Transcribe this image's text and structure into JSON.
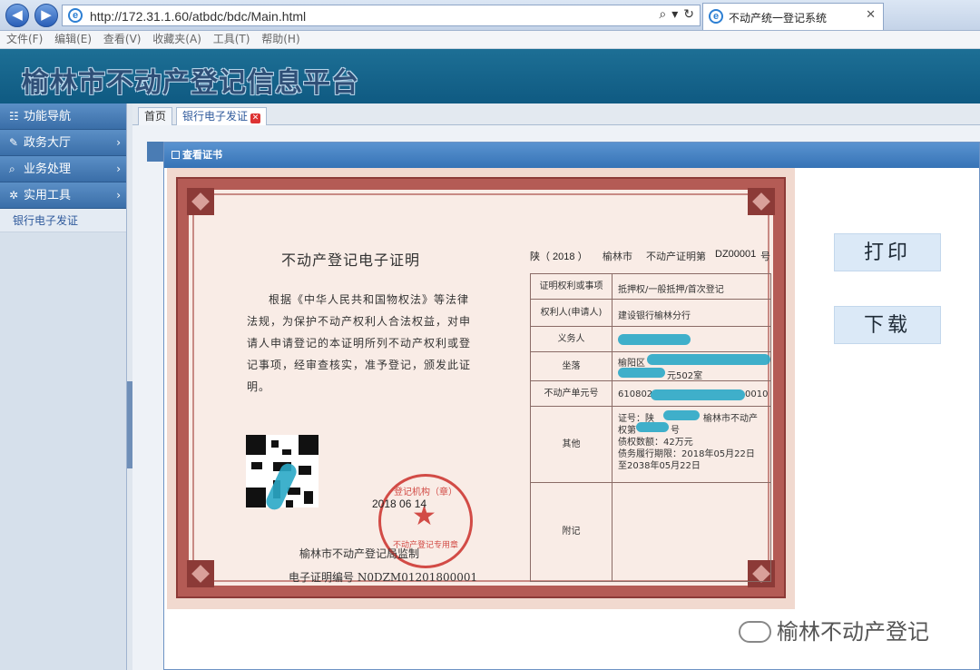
{
  "browser": {
    "url": "http://172.31.1.60/atbdc/bdc/Main.html",
    "tab_title": "不动产统一登记系统",
    "menu": [
      "文件(F)",
      "编辑(E)",
      "查看(V)",
      "收藏夹(A)",
      "工具(T)",
      "帮助(H)"
    ]
  },
  "app": {
    "title": "榆林市不动产登记信息平台"
  },
  "sidebar": {
    "items": [
      {
        "label": "功能导航",
        "icon": "list-icon"
      },
      {
        "label": "政务大厅",
        "icon": "edit-icon"
      },
      {
        "label": "业务处理",
        "icon": "search-icon"
      },
      {
        "label": "实用工具",
        "icon": "gear-icon"
      }
    ],
    "sub": "银行电子发证"
  },
  "tabs": [
    {
      "label": "首页"
    },
    {
      "label": "银行电子发证"
    }
  ],
  "dialog": {
    "title": "查看证书",
    "print_label": "打印",
    "download_label": "下载"
  },
  "certificate": {
    "title": "不动产登记电子证明",
    "body": "根据《中华人民共和国物权法》等法律法规，为保护不动产权利人合法权益，对申请人申请登记的本证明所列不动产权利或登记事项，经审查核实，准予登记，颁发此证明。",
    "seal_text": "登记机构（章）",
    "seal_label": "不动产登记专用章",
    "date": "2018 06 14",
    "supervision": "榆林市不动产登记局监制",
    "cert_no": "电子证明编号 N0DZM01201800001",
    "header_prefix": "陕（ 2018 ）",
    "header_city": "榆林市",
    "header_mid": "不动产证明第",
    "header_no": "DZ00001",
    "header_suffix": "号",
    "rows": [
      {
        "label": "证明权利或事项",
        "value": "抵押权/一般抵押/首次登记"
      },
      {
        "label": "权利人(申请人)",
        "value": "建设银行榆林分行"
      },
      {
        "label": "义务人",
        "value": ""
      },
      {
        "label": "坐落",
        "value": "榆阳区",
        "value2": "元502室"
      },
      {
        "label": "不动产单元号",
        "value": "610802",
        "value2": "0010"
      },
      {
        "label": "其他",
        "value": "证号：陕",
        "value1b": "榆林市不动产",
        "value2": "权第",
        "value2b": "号",
        "value3": "债权数额：42万元",
        "value4": "债务履行期限：2018年05月22日",
        "value5": "至2038年05月22日"
      },
      {
        "label": "附记",
        "value": ""
      }
    ]
  },
  "watermark": "榆林不动产登记"
}
